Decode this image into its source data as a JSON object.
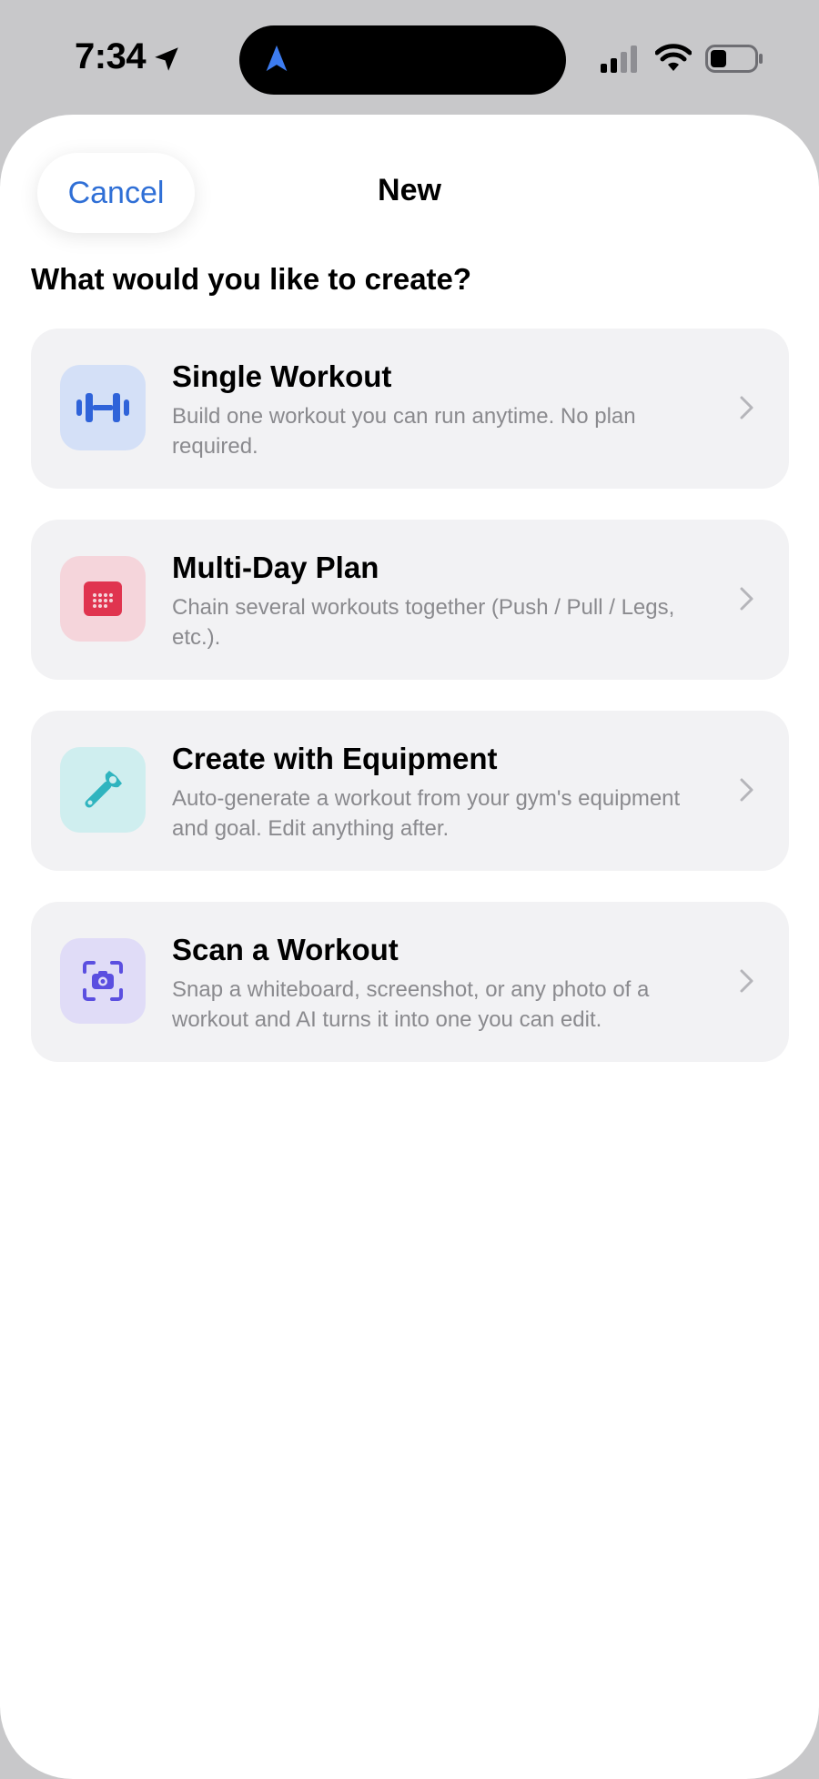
{
  "status_bar": {
    "time": "7:34",
    "icons": [
      "location-arrow-icon",
      "navigation-icon",
      "cellular-signal-icon",
      "wifi-icon",
      "battery-icon"
    ]
  },
  "header": {
    "cancel_label": "Cancel",
    "title": "New"
  },
  "question": "What would you like to create?",
  "options": [
    {
      "title": "Single Workout",
      "description": "Build one workout you can run anytime. No plan required.",
      "icon": "dumbbell-icon",
      "icon_color": "#2f63d9",
      "icon_bg": "#d4e0f7"
    },
    {
      "title": "Multi-Day Plan",
      "description": "Chain several workouts together (Push / Pull / Legs, etc.).",
      "icon": "calendar-icon",
      "icon_color": "#e0344f",
      "icon_bg": "#f5d5db"
    },
    {
      "title": "Create with Equipment",
      "description": "Auto-generate a workout from your gym's equipment and goal. Edit anything after.",
      "icon": "wrench-icon",
      "icon_color": "#2fb4bf",
      "icon_bg": "#cfeeef"
    },
    {
      "title": "Scan a Workout",
      "description": "Snap a whiteboard, screenshot, or any photo of a workout and AI turns it into one you can edit.",
      "icon": "camera-scan-icon",
      "icon_color": "#5b4fe0",
      "icon_bg": "#e0dcf7"
    }
  ],
  "colors": {
    "accent": "#2f6fd6",
    "card_bg": "#f2f2f4",
    "secondary_text": "#8a8a8e"
  }
}
